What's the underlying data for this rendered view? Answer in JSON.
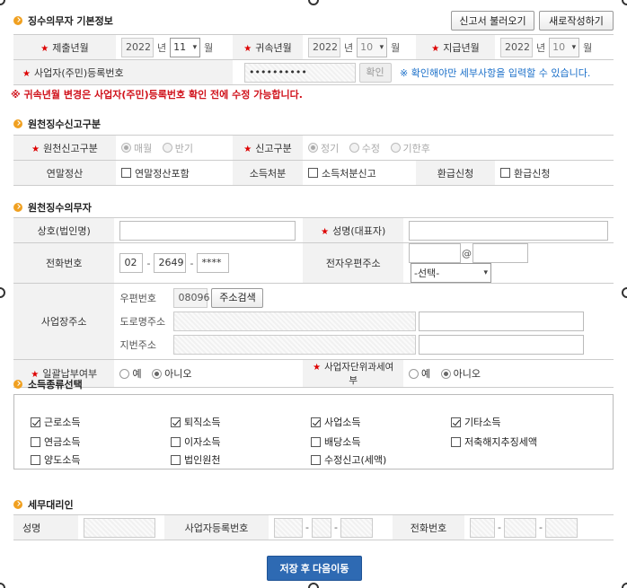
{
  "sections": {
    "basic": "징수의무자 기본정보",
    "report_type": "원천징수신고구분",
    "agent": "원천징수의무자",
    "income": "소득종류선택",
    "tax_agent": "세무대리인"
  },
  "buttons": {
    "load_report": "신고서 불러오기",
    "new_report": "새로작성하기",
    "confirm": "확인",
    "address_search": "주소검색",
    "save_next": "저장 후 다음이동"
  },
  "basic": {
    "submit_label": "제출년월",
    "submit_year": "2022",
    "submit_month": "11",
    "belong_label": "귀속년월",
    "belong_year": "2022",
    "belong_month": "10",
    "pay_label": "지급년월",
    "pay_year": "2022",
    "pay_month": "10",
    "year_unit": "년",
    "month_unit": "월",
    "regno_label": "사업자(주민)등록번호",
    "regno_value": "••••••••••",
    "confirm_note": "※ 확인해야만 세부사항을 입력할 수 있습니다.",
    "warning": "※ 귀속년월 변경은 사업자(주민)등록번호 확인 전에 수정 가능합니다."
  },
  "report_type": {
    "report_label": "원천신고구분",
    "report_opts": [
      "매월",
      "반기"
    ],
    "filing_label": "신고구분",
    "filing_opts": [
      "정기",
      "수정",
      "기한후"
    ],
    "yearend_label": "연말정산",
    "yearend_opt": "연말정산포함",
    "income_disp_label": "소득처분",
    "income_disp_opt": "소득처분신고",
    "refund_label": "환급신청",
    "refund_opt": "환급신청"
  },
  "agent": {
    "company_label": "상호(법인명)",
    "ceo_label": "성명(대표자)",
    "phone_label": "전화번호",
    "phone1": "02",
    "phone2": "2649",
    "phone3": "****",
    "email_label": "전자우편주소",
    "email_at": "@",
    "email_select": "-선택-",
    "address_label": "사업장주소",
    "zip_label": "우편번호",
    "zip_value": "08096",
    "road_label": "도로명주소",
    "lot_label": "지번주소",
    "lump_label": "일괄납부여부",
    "lump_opts": [
      "예",
      "아니오"
    ],
    "unit_tax_label": "사업자단위과세여부",
    "unit_tax_opts": [
      "예",
      "아니오"
    ]
  },
  "income": {
    "items": [
      {
        "label": "근로소득",
        "checked": true
      },
      {
        "label": "퇴직소득",
        "checked": true
      },
      {
        "label": "사업소득",
        "checked": true
      },
      {
        "label": "기타소득",
        "checked": true
      },
      {
        "label": "연금소득",
        "checked": false
      },
      {
        "label": "이자소득",
        "checked": false
      },
      {
        "label": "배당소득",
        "checked": false
      },
      {
        "label": "저축해지추징세액",
        "checked": false
      },
      {
        "label": "양도소득",
        "checked": false
      },
      {
        "label": "법인원천",
        "checked": false
      },
      {
        "label": "수정신고(세액)",
        "checked": false
      }
    ]
  },
  "tax_agent": {
    "name_label": "성명",
    "bizno_label": "사업자등록번호",
    "phone_label": "전화번호",
    "dash": "-"
  },
  "colors": {
    "required": "#d00000",
    "warning": "#d0121b",
    "info": "#1a6fc9",
    "primary_button": "#2e6ab3",
    "bullet": "#f0a020"
  }
}
